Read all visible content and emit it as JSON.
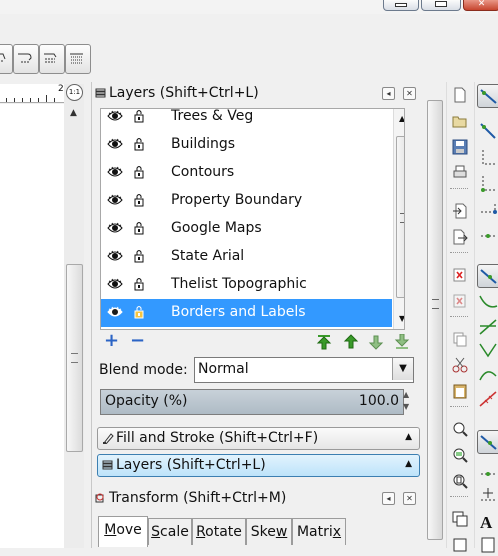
{
  "layers_panel": {
    "title": "Layers (Shift+Ctrl+L)",
    "layers": [
      {
        "name": "Trees & Veg",
        "selected": false
      },
      {
        "name": "Buildings",
        "selected": false
      },
      {
        "name": "Contours",
        "selected": false
      },
      {
        "name": "Property Boundary",
        "selected": false
      },
      {
        "name": "Google Maps",
        "selected": false
      },
      {
        "name": "State Arial",
        "selected": false
      },
      {
        "name": "Thelist Topographic",
        "selected": false
      },
      {
        "name": "Borders and Labels",
        "selected": true
      }
    ],
    "blend_mode_label": "Blend mode:",
    "blend_mode_value": "Normal",
    "opacity_label": "Opacity (%)",
    "opacity_value": "100.0"
  },
  "collapsed_panels": {
    "fill_stroke": "Fill and Stroke (Shift+Ctrl+F)",
    "layers": "Layers (Shift+Ctrl+L)"
  },
  "transform_panel": {
    "title": "Transform (Shift+Ctrl+M)",
    "tabs": [
      {
        "pre": "",
        "key": "M",
        "post": "ove"
      },
      {
        "pre": "",
        "key": "S",
        "post": "cale"
      },
      {
        "pre": "",
        "key": "R",
        "post": "otate"
      },
      {
        "pre": "Ske",
        "key": "w",
        "post": ""
      },
      {
        "pre": "Matri",
        "key": "x",
        "post": ""
      }
    ]
  },
  "ruler": {
    "label": "2"
  },
  "colors": {
    "selection": "#3399ff",
    "accent_blue": "#2b64c5",
    "arrow_green": "#3a9a2a",
    "active_tab_highlight": "#bde3fa"
  }
}
